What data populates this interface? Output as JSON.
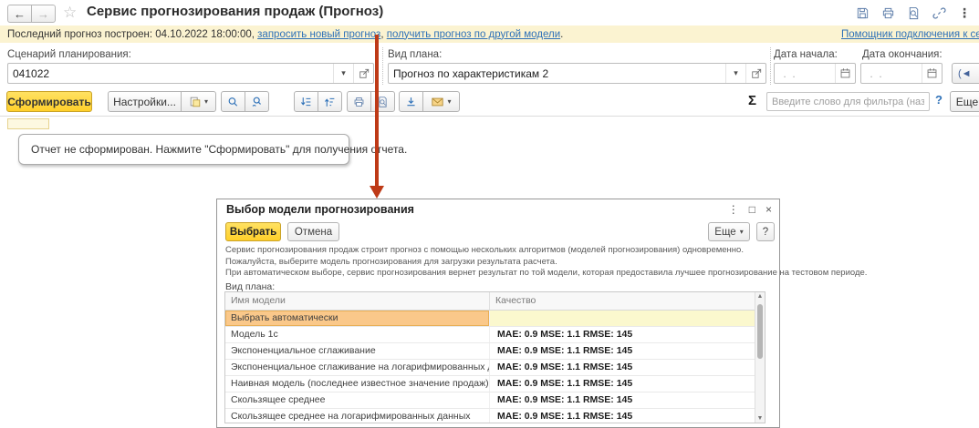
{
  "colors": {
    "notification_bg": "#FBF3D1",
    "link_blue": "#2E71B8",
    "arrow_red": "#BE3A17",
    "accent_yellow": "#FFD73E",
    "selected_row_bg": "#FAC88A",
    "selected_row_border": "#E8AE55",
    "selected_row_alt_bg": "#FBF8CE"
  },
  "glyphs": {
    "back": "←",
    "forward": "→",
    "star": "☆",
    "kebab": "⋮",
    "dropdown": "▾",
    "sigma": "Σ",
    "maximize": "□",
    "close": "×",
    "scroll_up": "▲",
    "scroll_down": "▼",
    "period_button": "(◄"
  },
  "header": {
    "title": "Сервис прогнозирования продаж (Прогноз)"
  },
  "notification": {
    "prefix": "Последний прогноз построен: 04.10.2022 18:00:00, ",
    "link_request": "запросить новый прогноз",
    "separator": ", ",
    "link_other_model": "получить прогноз по другой модели",
    "suffix": ".",
    "assistant_link": "Помощник подключения к сервису"
  },
  "filters": {
    "scenario": {
      "label": "Сценарий планирования:",
      "value": "041022"
    },
    "plan_kind": {
      "label": "Вид плана:",
      "value": "Прогноз по характеристикам 2"
    },
    "date_start": {
      "label": "Дата начала:",
      "placeholder": " .  . "
    },
    "date_end": {
      "label": "Дата окончания:",
      "placeholder": " .  . "
    }
  },
  "toolbar": {
    "generate_label": "Сформировать",
    "settings_label": "Настройки...",
    "filter_placeholder": "Введите слово для фильтра (название товара, покупателя и пр.)",
    "help_label": "?",
    "more_label": "Еще"
  },
  "report": {
    "message": "Отчет не сформирован. Нажмите \"Сформировать\" для получения отчета."
  },
  "dialog": {
    "title": "Выбор модели прогнозирования",
    "select_label": "Выбрать",
    "cancel_label": "Отмена",
    "more_label": "Еще",
    "help_label": "?",
    "description": [
      "Сервис прогнозирования продаж строит прогноз с помощью нескольких алгоритмов (моделей прогнозирования) одновременно.",
      "Пожалуйста, выберите модель прогнозирования для загрузки результата расчета.",
      "При автоматическом выборе, сервис прогнозирования вернет результат по той модели, которая предоставила лучшее прогнозирование на тестовом периоде."
    ],
    "plan_label": "Вид плана:",
    "table": {
      "headers": [
        "Имя модели",
        "Качество"
      ],
      "rows": [
        {
          "name": "Выбрать автоматически",
          "quality": "",
          "selected": true
        },
        {
          "name": "Модель 1с",
          "quality": "MAE: 0.9 MSE: 1.1 RMSE: 145",
          "selected": false
        },
        {
          "name": "Экспоненциальное сглаживание",
          "quality": "MAE: 0.9 MSE: 1.1 RMSE: 145",
          "selected": false
        },
        {
          "name": "Экспоненциальное сглаживание на логарифмированных данных",
          "quality": "MAE: 0.9 MSE: 1.1 RMSE: 145",
          "selected": false
        },
        {
          "name": "Наивная модель (последнее известное значение продаж)",
          "quality": "MAE: 0.9 MSE: 1.1 RMSE: 145",
          "selected": false
        },
        {
          "name": "Скользящее среднее",
          "quality": "MAE: 0.9 MSE: 1.1 RMSE: 145",
          "selected": false
        },
        {
          "name": "Скользящее среднее на логарифмированных данных",
          "quality": "MAE: 0.9 MSE: 1.1 RMSE: 145",
          "selected": false
        }
      ]
    }
  }
}
